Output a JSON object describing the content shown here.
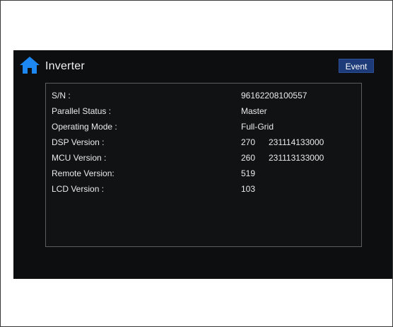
{
  "header": {
    "title": "Inverter",
    "event_label": "Event",
    "home_icon": "home-icon",
    "accent_color": "#1E88F2",
    "button_color": "#1D3B78"
  },
  "info": {
    "rows": [
      {
        "label": "S/N :",
        "value": "96162208100557",
        "value2": ""
      },
      {
        "label": "Parallel Status :",
        "value": "Master",
        "value2": ""
      },
      {
        "label": "Operating Mode :",
        "value": "Full-Grid",
        "value2": ""
      },
      {
        "label": "DSP Version :",
        "value": "270",
        "value2": "231114133000"
      },
      {
        "label": "MCU Version :",
        "value": "260",
        "value2": "231113133000"
      },
      {
        "label": "Remote Version:",
        "value": "519",
        "value2": ""
      },
      {
        "label": "LCD Version :",
        "value": "103",
        "value2": ""
      }
    ]
  }
}
